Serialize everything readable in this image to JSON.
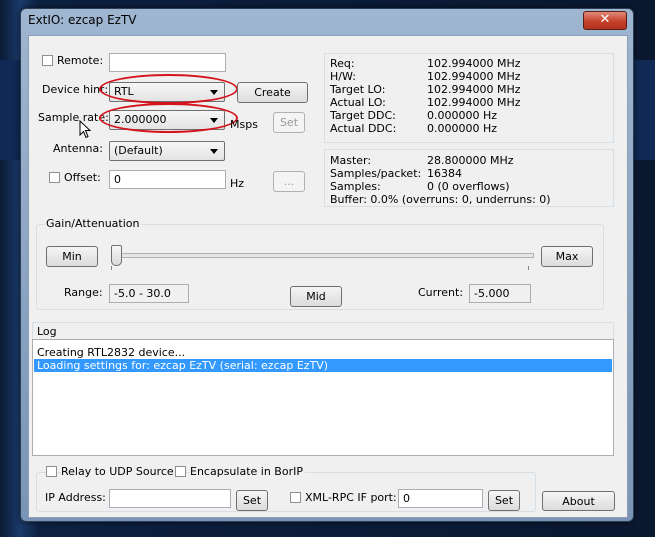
{
  "window": {
    "title": "ExtIO: ezcap EzTV",
    "close_glyph": "✕"
  },
  "left": {
    "remote_label": "Remote:",
    "device_hint_label": "Device hint:",
    "device_hint_value": "RTL",
    "create_label": "Create",
    "sample_rate_label": "Sample rate:",
    "sample_rate_value": "2.000000",
    "msps_label": "Msps",
    "set_label": "Set",
    "antenna_label": "Antenna:",
    "antenna_value": "(Default)",
    "offset_label": "Offset:",
    "offset_value": "0",
    "hz_label": "Hz",
    "ellipsis_label": "..."
  },
  "freq_info": {
    "rows": [
      {
        "label": "Req:",
        "value": "102.994000 MHz"
      },
      {
        "label": "H/W:",
        "value": "102.994000 MHz"
      },
      {
        "label": "Target LO:",
        "value": "102.994000 MHz"
      },
      {
        "label": "Actual LO:",
        "value": "102.994000 MHz"
      },
      {
        "label": "Target DDC:",
        "value": "0.000000 Hz"
      },
      {
        "label": "Actual DDC:",
        "value": "0.000000 Hz"
      }
    ]
  },
  "stream_info": {
    "master_label": "Master:",
    "master_value": "28.800000 MHz",
    "spp_label": "Samples/packet:",
    "spp_value": "16384",
    "samples_label": "Samples:",
    "samples_value": "0 (0 overflows)",
    "buffer_text": "Buffer: 0.0% (overruns: 0, underruns: 0)"
  },
  "gain": {
    "group_title": "Gain/Attenuation",
    "min_label": "Min",
    "max_label": "Max",
    "range_label": "Range:",
    "range_value": "-5.0 - 30.0",
    "mid_label": "Mid",
    "current_label": "Current:",
    "current_value": "-5.000",
    "slider_level": 0
  },
  "log": {
    "title": "Log",
    "lines": [
      {
        "text": "Creating RTL2832 device...",
        "selected": false
      },
      {
        "text": "Loading settings for: ezcap EzTV (serial: ezcap EzTV)",
        "selected": true
      }
    ]
  },
  "bottom": {
    "relay_label": "Relay to UDP Source",
    "encapsulate_label": "Encapsulate in BorIP",
    "ip_label": "IP Address:",
    "ip_value": "",
    "set1_label": "Set",
    "xmlrpc_label": "XML-RPC IF port:",
    "xmlrpc_value": "0",
    "set2_label": "Set",
    "about_label": "About"
  },
  "colors": {
    "selection": "#3399ff",
    "annotation": "#d4141c"
  }
}
